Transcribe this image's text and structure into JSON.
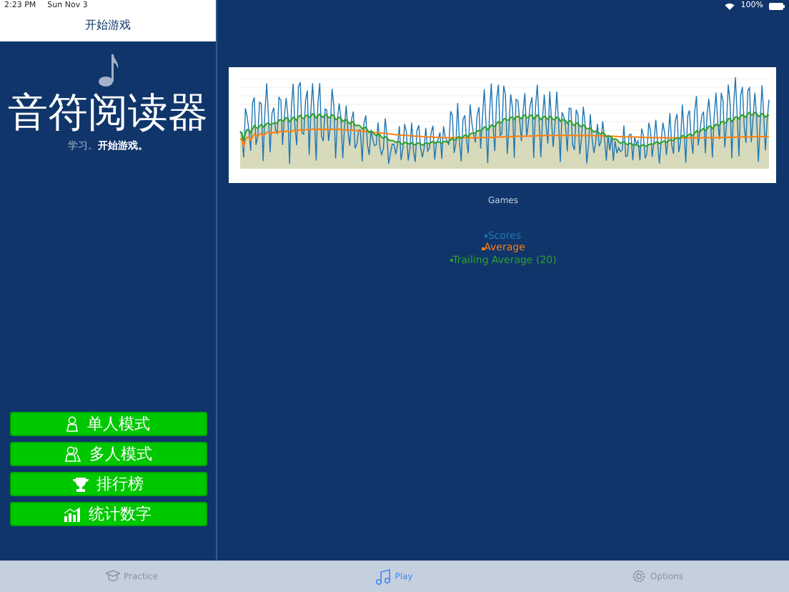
{
  "status_bar": {
    "time": "2:23 PM",
    "date": "Sun Nov 3",
    "battery": "100%"
  },
  "sidebar": {
    "title": "开始游戏",
    "app_name": "音符阅读器",
    "tagline": "学习。**开始游戏。**",
    "buttons": [
      {
        "label": "单人模式",
        "kind": "single"
      },
      {
        "label": "多人模式",
        "kind": "multi"
      },
      {
        "label": "排行榜",
        "kind": "trophy"
      },
      {
        "label": "统计数字",
        "kind": "stats"
      }
    ]
  },
  "chart": {
    "xlabel": "Games",
    "legend": [
      {
        "label": "Scores",
        "color": "#1f77b4"
      },
      {
        "label": "Average",
        "color": "#ff7f0e"
      },
      {
        "label": "Trailing Average (20)",
        "color": "#2ca02c"
      }
    ]
  },
  "tab_bar": [
    {
      "label": "Practice",
      "kind": "practice",
      "selected": false
    },
    {
      "label": "Play",
      "kind": "play",
      "selected": true
    },
    {
      "label": "Options",
      "kind": "options",
      "selected": false
    }
  ]
}
